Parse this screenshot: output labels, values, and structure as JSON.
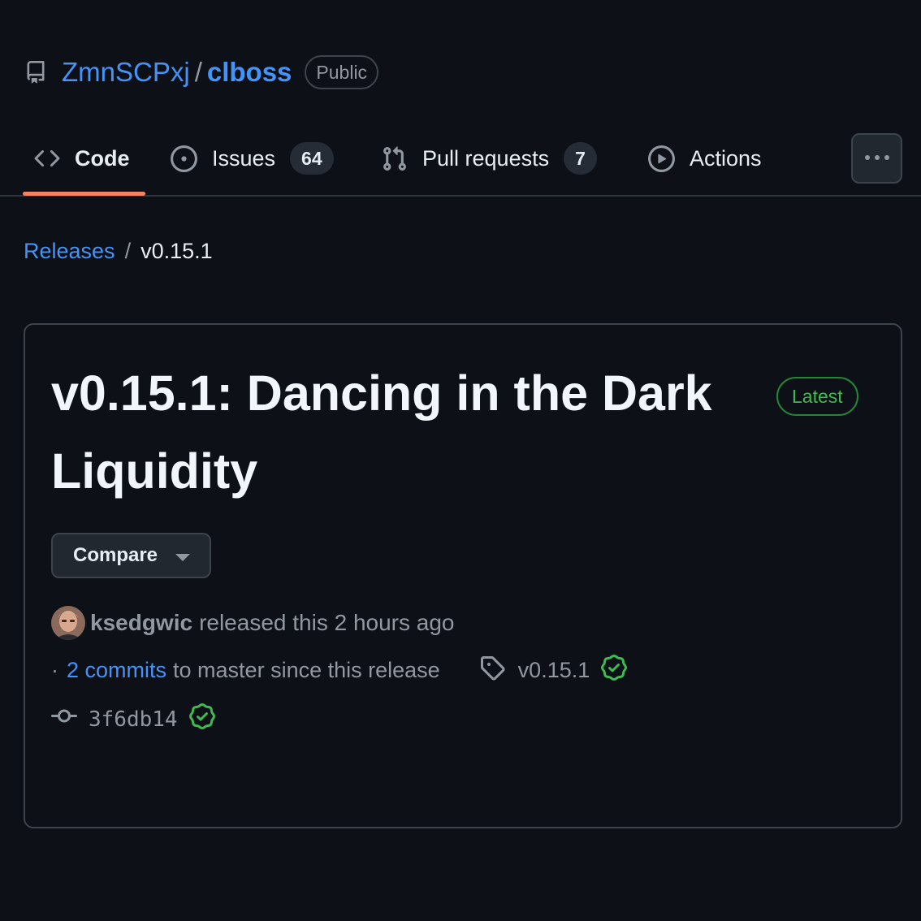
{
  "repo": {
    "owner": "ZmnSCPxj",
    "separator": "/",
    "name": "clboss",
    "visibility": "Public"
  },
  "tabs": [
    {
      "label": "Code",
      "icon": "code-icon",
      "selected": true
    },
    {
      "label": "Issues",
      "icon": "issue-opened-icon",
      "count": "64"
    },
    {
      "label": "Pull requests",
      "icon": "git-pull-request-icon",
      "count": "7"
    },
    {
      "label": "Actions",
      "icon": "play-icon"
    }
  ],
  "breadcrumb": {
    "parent": "Releases",
    "separator": "/",
    "current": "v0.15.1"
  },
  "release": {
    "title": "v0.15.1: Dancing in the Dark Liquidity",
    "badge": "Latest",
    "compare_label": "Compare",
    "author": "ksedgwic",
    "released_text": "released this 2 hours ago",
    "commits_dot": "·",
    "commits_link": "2 commits",
    "commits_text": "to master since this release",
    "tag": "v0.15.1",
    "commit_sha": "3f6db14"
  },
  "colors": {
    "background": "#0d1117",
    "link": "#4493f8",
    "muted": "#9198a1",
    "success": "#3fb950",
    "tab_underline": "#f78166"
  }
}
